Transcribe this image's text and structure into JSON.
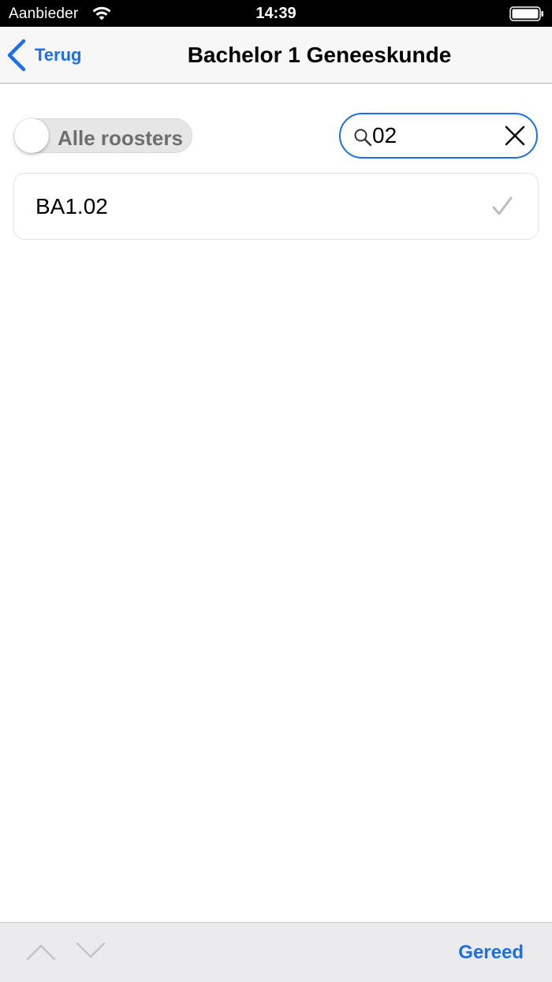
{
  "status_bar": {
    "carrier": "Aanbieder",
    "time": "14:39",
    "wifi_icon": "wifi-icon",
    "battery_icon": "battery-full-icon"
  },
  "nav": {
    "back_label": "Terug",
    "back_icon": "chevron-left-icon",
    "title": "Bachelor 1 Geneeskunde"
  },
  "filter": {
    "toggle_label": "Alle roosters",
    "toggle_on": false
  },
  "search": {
    "value": "02",
    "icon": "search-icon",
    "clear_icon": "close-icon"
  },
  "results": [
    {
      "label": "BA1.02",
      "checked": true,
      "check_icon": "checkmark-icon"
    }
  ],
  "bottom_bar": {
    "prev_icon": "chevron-up-icon",
    "next_icon": "chevron-down-icon",
    "done_label": "Gereed"
  },
  "colors": {
    "accent": "#1b6fe8",
    "nav_background": "#f7f7f7",
    "bottom_bar_background": "#ebebed",
    "check": "#bdbdbd"
  }
}
